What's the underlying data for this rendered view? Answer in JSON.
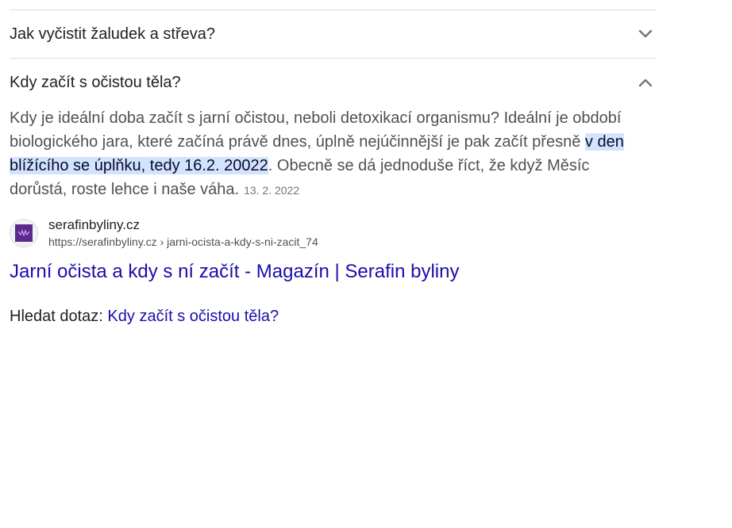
{
  "faq": {
    "collapsed_question": "Jak vyčistit žaludek a střeva?",
    "expanded_question": "Kdy začít s očistou těla?",
    "answer": {
      "text_before": "Kdy je ideální doba začít s jarní očistou, neboli detoxikací organismu? Ideální je období biologického jara, které začíná právě dnes, úplně nejúčinnější je pak začít přesně ",
      "highlighted": "v den blížícího se úplňku, tedy 16.2. 20022",
      "text_after": ". Obecně se dá jednoduše říct, že když Měsíc dorůstá, roste lehce i naše váha.",
      "date": "13. 2. 2022"
    },
    "source": {
      "site_name": "serafinbyliny.cz",
      "url": "https://serafinbyliny.cz › jarni-ocista-a-kdy-s-ni-zacit_74",
      "favicon_icon": "serafin-logo-icon",
      "favicon_color": "#5b2a8c"
    },
    "result_title": "Jarní očista a kdy s ní začít - Magazín | Serafin byliny",
    "search_more_label": "Hledat dotaz:",
    "search_more_query": "Kdy začít s očistou těla?"
  },
  "colors": {
    "link": "#1a0dab",
    "highlight": "#d3e3fd",
    "divider": "#dadce0"
  }
}
